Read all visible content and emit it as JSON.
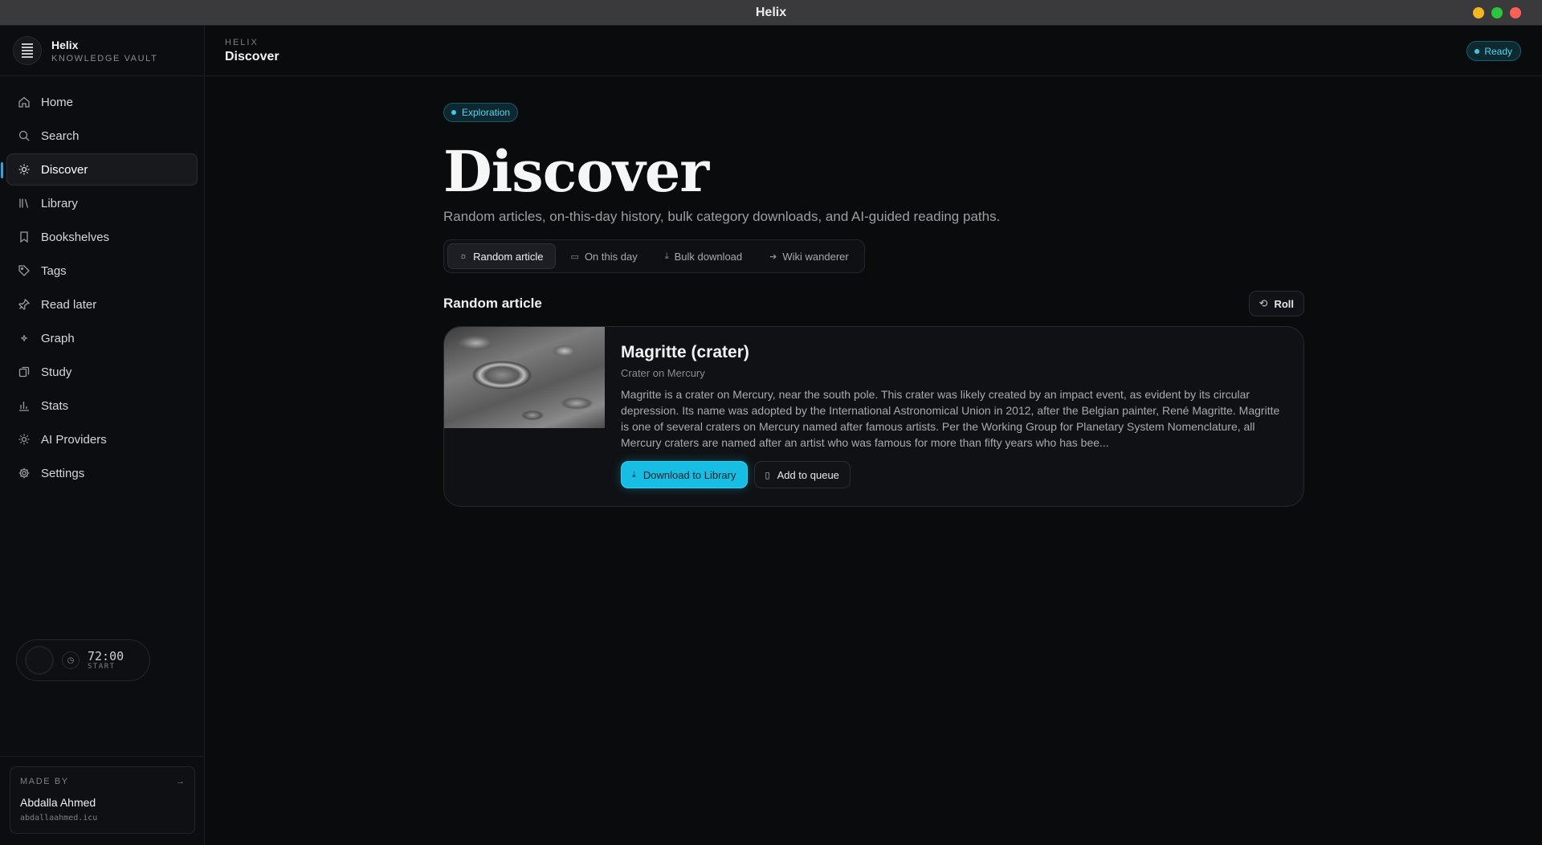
{
  "window": {
    "title": "Helix"
  },
  "brand": {
    "name": "Helix",
    "subtitle": "KNOWLEDGE VAULT"
  },
  "sidebar": {
    "items": [
      {
        "label": "Home",
        "icon": "home-icon"
      },
      {
        "label": "Search",
        "icon": "search-icon"
      },
      {
        "label": "Discover",
        "icon": "sparkle-icon",
        "active": true
      },
      {
        "label": "Library",
        "icon": "library-icon"
      },
      {
        "label": "Bookshelves",
        "icon": "bookmark-icon"
      },
      {
        "label": "Tags",
        "icon": "tag-icon"
      },
      {
        "label": "Read later",
        "icon": "pin-icon"
      },
      {
        "label": "Graph",
        "icon": "graph-icon"
      },
      {
        "label": "Study",
        "icon": "cards-icon"
      },
      {
        "label": "Stats",
        "icon": "bar-chart-icon"
      },
      {
        "label": "AI Providers",
        "icon": "sparkle-icon"
      },
      {
        "label": "Settings",
        "icon": "gear-icon"
      }
    ]
  },
  "timer": {
    "time": "72:00",
    "label": "START"
  },
  "made_by": {
    "kicker": "MADE BY",
    "name": "Abdalla Ahmed",
    "link": "abdallaahmed.icu",
    "arrow": "→"
  },
  "header": {
    "breadcrumb": "HELIX",
    "title": "Discover",
    "status": "Ready"
  },
  "page": {
    "badge": "Exploration",
    "title": "Discover",
    "subtitle": "Random articles, on-this-day history, bulk category downloads, and AI-guided reading paths."
  },
  "tabs": [
    {
      "label": "Random article",
      "icon": "sparkle-icon",
      "active": true
    },
    {
      "label": "On this day",
      "icon": "calendar-icon"
    },
    {
      "label": "Bulk download",
      "icon": "download-icon"
    },
    {
      "label": "Wiki wanderer",
      "icon": "wand-icon"
    }
  ],
  "section": {
    "title": "Random article",
    "roll_label": "Roll"
  },
  "article": {
    "title": "Magritte (crater)",
    "subtitle": "Crater on Mercury",
    "summary": "Magritte is a crater on Mercury, near the south pole. This crater was likely created by an impact event, as evident by its circular depression. Its name was adopted by the International Astronomical Union in 2012, after the Belgian painter, René Magritte. Magritte is one of several craters on Mercury named after famous artists. Per the Working Group for Planetary System Nomenclature, all Mercury craters are named after an artist who was famous for more than fifty years who has bee...",
    "primary_action": "Download to Library",
    "secondary_action": "Add to queue"
  },
  "colors": {
    "accent": "#17bde3",
    "background": "#0a0b0d",
    "active_indicator": "#2aa7e0"
  }
}
